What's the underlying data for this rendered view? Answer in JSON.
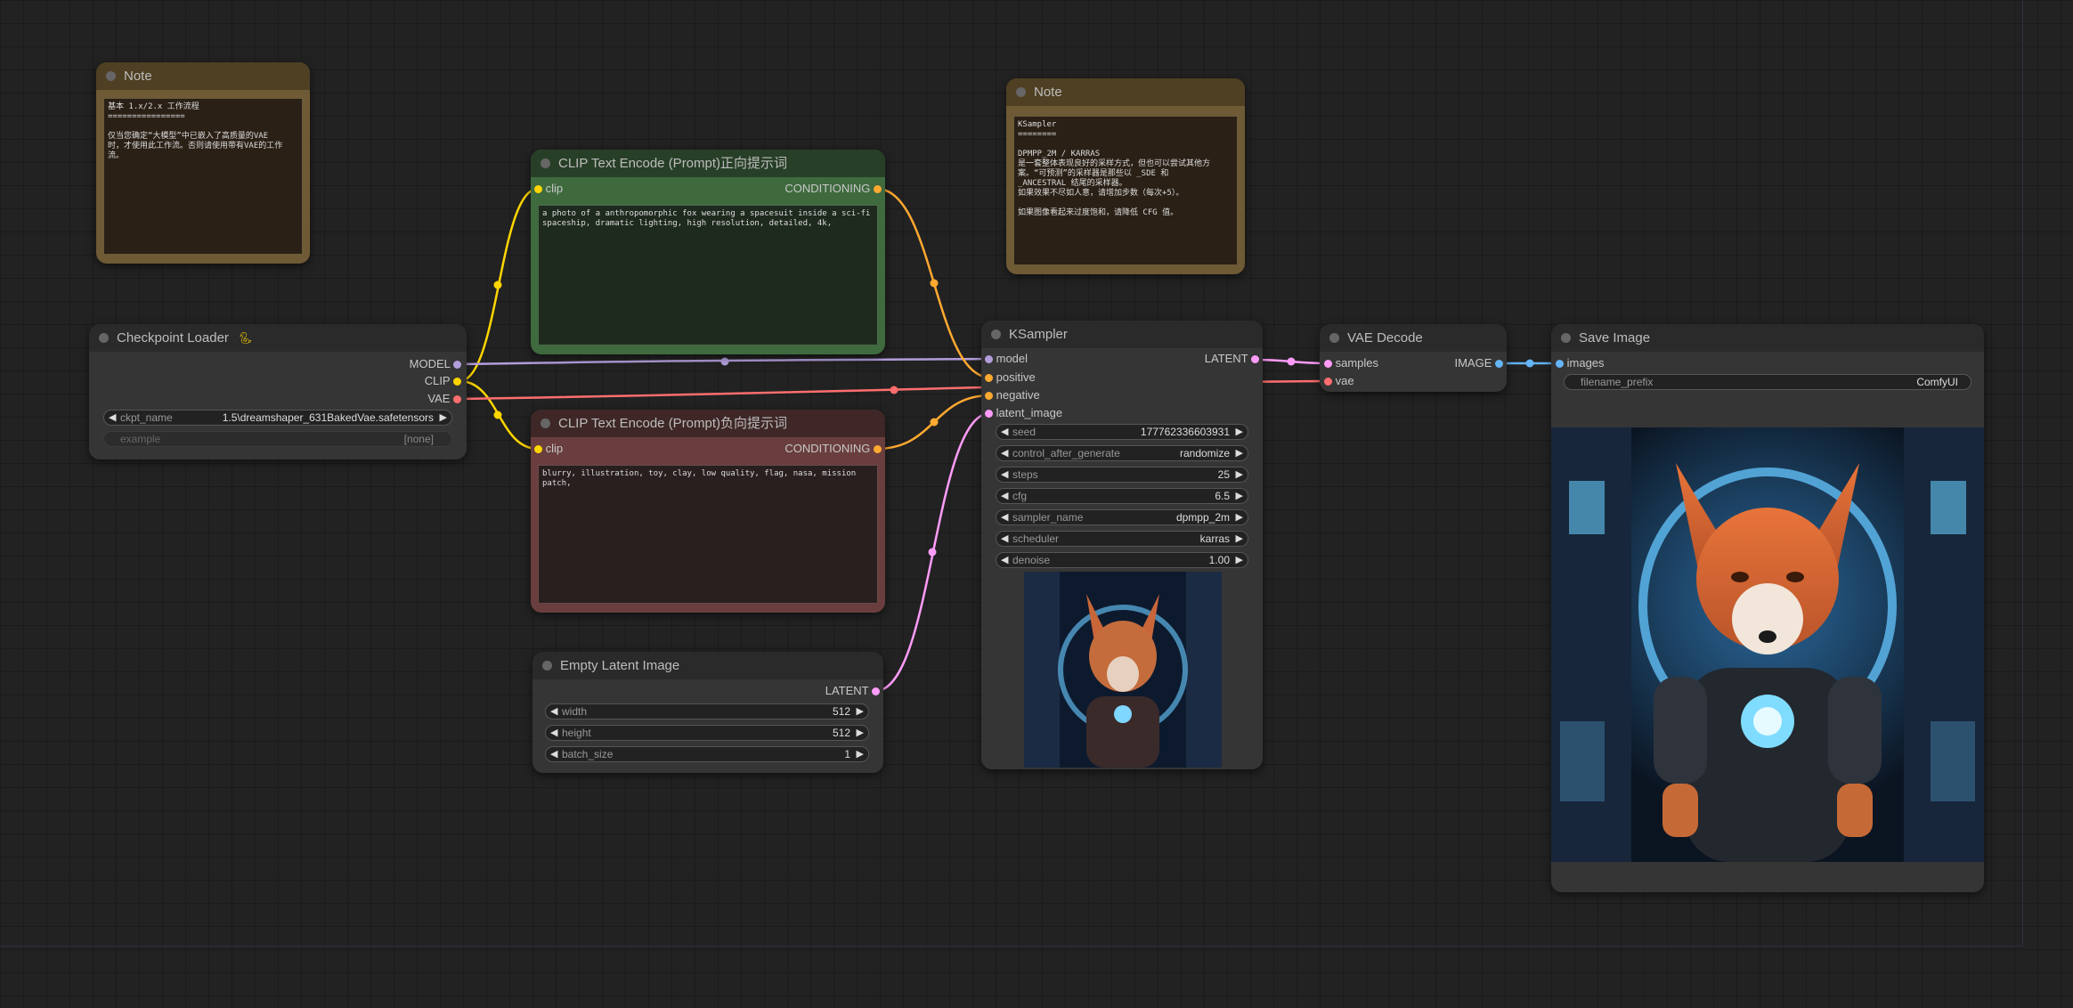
{
  "note1": {
    "title": "Note",
    "text": "基本 1.x/2.x 工作流程\n================\n\n仅当您确定“大模型”中已嵌入了高质量的VAE\n时，才使用此工作流。否则请使用带有VAE的工作流。"
  },
  "note2": {
    "title": "Note",
    "text": "KSampler\n========\n\nDPMPP_2M / KARRAS\n是一套整体表现良好的采样方式，但也可以尝试其他方案。“可预测”的采样器是那些以 _SDE 和\n_ANCESTRAL 结尾的采样器。\n如果效果不尽如人意，请增加步数（每次+5）。\n\n如果图像看起来过度饱和，请降低 CFG 值。"
  },
  "checkpoint": {
    "title": "Checkpoint Loader",
    "title_icon": "snake-icon",
    "outputs": [
      "MODEL",
      "CLIP",
      "VAE"
    ],
    "ckpt_label": "ckpt_name",
    "ckpt_value": "1.5\\dreamshaper_631BakedVae.safetensors",
    "example_label": "example",
    "example_value": "[none]"
  },
  "clip_pos": {
    "title": "CLIP Text Encode (Prompt)正向提示词",
    "input": "clip",
    "output": "CONDITIONING",
    "text": "a photo of a anthropomorphic fox wearing a spacesuit inside a sci-fi spaceship, dramatic lighting, high resolution, detailed, 4k,"
  },
  "clip_neg": {
    "title": "CLIP Text Encode (Prompt)负向提示词",
    "input": "clip",
    "output": "CONDITIONING",
    "text": "blurry, illustration, toy, clay, low quality, flag, nasa, mission patch,"
  },
  "latent": {
    "title": "Empty Latent Image",
    "output": "LATENT",
    "widgets": [
      {
        "label": "width",
        "value": "512"
      },
      {
        "label": "height",
        "value": "512"
      },
      {
        "label": "batch_size",
        "value": "1"
      }
    ]
  },
  "ksampler": {
    "title": "KSampler",
    "inputs": [
      "model",
      "positive",
      "negative",
      "latent_image"
    ],
    "output": "LATENT",
    "widgets": [
      {
        "label": "seed",
        "value": "177762336603931"
      },
      {
        "label": "control_after_generate",
        "value": "randomize"
      },
      {
        "label": "steps",
        "value": "25"
      },
      {
        "label": "cfg",
        "value": "6.5"
      },
      {
        "label": "sampler_name",
        "value": "dpmpp_2m"
      },
      {
        "label": "scheduler",
        "value": "karras"
      },
      {
        "label": "denoise",
        "value": "1.00"
      }
    ]
  },
  "vae_decode": {
    "title": "VAE Decode",
    "inputs": [
      "samples",
      "vae"
    ],
    "output": "IMAGE"
  },
  "save_image": {
    "title": "Save Image",
    "input": "images",
    "prefix_label": "filename_prefix",
    "prefix_value": "ComfyUI"
  },
  "colors": {
    "model": "#b39ddb",
    "clip": "#ffd500",
    "vae": "#ff6e6e",
    "conditioning": "#ffa931",
    "latent": "#ff9cf9",
    "image": "#64b5f6",
    "note_bg": "#432",
    "pos_bg": "#335533",
    "neg_bg": "#553333"
  }
}
